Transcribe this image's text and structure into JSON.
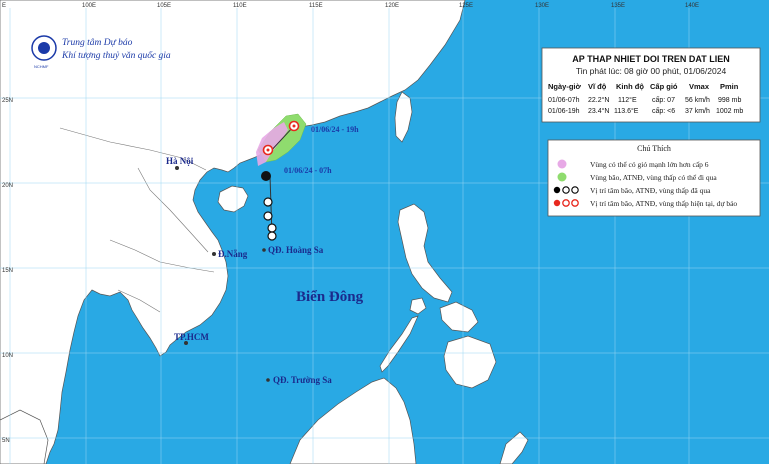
{
  "header": {
    "org_line1": "Trung tâm Dự báo",
    "org_line2": "Khí tượng thuỷ văn quốc gia",
    "logo_caption": "NCHMF"
  },
  "grid": {
    "lon_labels": [
      "E",
      "100E",
      "105E",
      "110E",
      "115E",
      "120E",
      "125E",
      "130E",
      "135E",
      "140E"
    ],
    "lat_labels": [
      "25N",
      "20N",
      "15N",
      "10N",
      "5N"
    ]
  },
  "info": {
    "title": "AP THAP NHIET DOI TREN DAT LIEN",
    "issued": "Tin phát lúc: 08 giờ 00 phút, 01/06/2024",
    "headers": [
      "Ngày-giờ",
      "Vĩ độ",
      "Kinh độ",
      "Cấp gió",
      "Vmax",
      "Pmin"
    ],
    "rows": [
      [
        "01/06-07h",
        "22.2°N",
        "112°E",
        "cấp: 07",
        "56 km/h",
        "998 mb"
      ],
      [
        "01/06-19h",
        "23.4°N",
        "113.6°E",
        "cấp: <6",
        "37 km/h",
        "1002 mb"
      ]
    ]
  },
  "legend": {
    "title": "Chú Thích",
    "items": [
      "Vùng có thể có gió mạnh lớn hơn cấp 6",
      "Vùng bão, ATNĐ, vùng thấp có thể đi qua",
      "Vị trí tâm bão, ATNĐ, vùng thấp đã qua",
      "Vị trí tâm bão, ATNĐ, vùng thấp hiện tại, dự báo"
    ],
    "colors": {
      "strong_wind": "#e7a9e6",
      "forecast_cone": "#8fdc6e",
      "past": "#000000",
      "forecast": "#e8281e"
    }
  },
  "places": {
    "hanoi": "Hà Nội",
    "danang": "Đ.Nẵng",
    "hoangsa": "QĐ. Hoàng Sa",
    "hcm": "TP.HCM",
    "truongsa": "QĐ. Trường Sa",
    "sea": "Biển Đông"
  },
  "storm": {
    "forecast_label": "01/06/24 - 19h",
    "current_label": "01/06/24 - 07h"
  },
  "colors": {
    "sea": "#29a9e4",
    "land": "#ffffff",
    "border": "#666666"
  }
}
